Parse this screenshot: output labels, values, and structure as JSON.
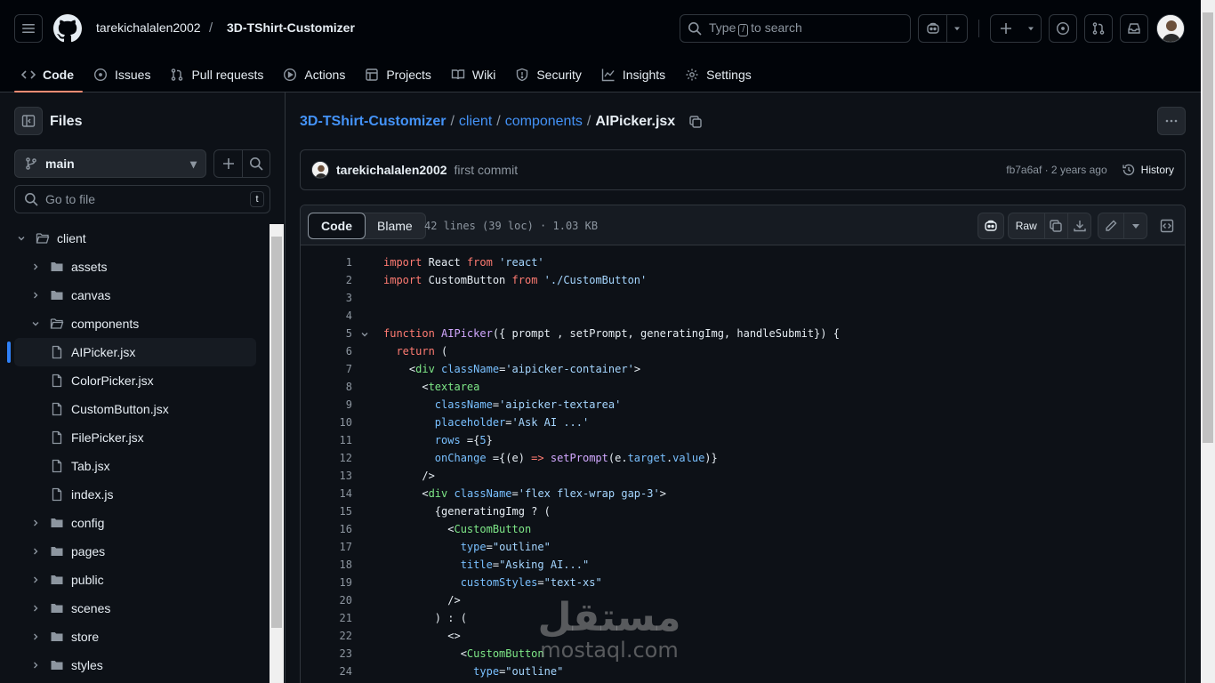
{
  "header": {
    "owner": "tarekichalalen2002",
    "separator": "/",
    "repo": "3D-TShirt-Customizer",
    "search": {
      "prefix": "Type",
      "key": "/",
      "suffix": "to search"
    }
  },
  "tabs": [
    {
      "label": "Code",
      "icon": "code-icon",
      "active": true
    },
    {
      "label": "Issues",
      "icon": "issue-icon"
    },
    {
      "label": "Pull requests",
      "icon": "pull-request-icon"
    },
    {
      "label": "Actions",
      "icon": "play-icon"
    },
    {
      "label": "Projects",
      "icon": "table-icon"
    },
    {
      "label": "Wiki",
      "icon": "book-icon"
    },
    {
      "label": "Security",
      "icon": "shield-icon"
    },
    {
      "label": "Insights",
      "icon": "graph-icon"
    },
    {
      "label": "Settings",
      "icon": "gear-icon"
    }
  ],
  "sidebar": {
    "title": "Files",
    "branch": "main",
    "goto_placeholder": "Go to file",
    "goto_key": "t",
    "tree": [
      {
        "label": "client",
        "type": "folder",
        "open": true,
        "depth": 0
      },
      {
        "label": "assets",
        "type": "folder",
        "depth": 1
      },
      {
        "label": "canvas",
        "type": "folder",
        "depth": 1
      },
      {
        "label": "components",
        "type": "folder",
        "open": true,
        "depth": 1
      },
      {
        "label": "AIPicker.jsx",
        "type": "file",
        "depth": 2,
        "selected": true
      },
      {
        "label": "ColorPicker.jsx",
        "type": "file",
        "depth": 2
      },
      {
        "label": "CustomButton.jsx",
        "type": "file",
        "depth": 2
      },
      {
        "label": "FilePicker.jsx",
        "type": "file",
        "depth": 2
      },
      {
        "label": "Tab.jsx",
        "type": "file",
        "depth": 2
      },
      {
        "label": "index.js",
        "type": "file",
        "depth": 2
      },
      {
        "label": "config",
        "type": "folder",
        "depth": 1
      },
      {
        "label": "pages",
        "type": "folder",
        "depth": 1
      },
      {
        "label": "public",
        "type": "folder",
        "depth": 1
      },
      {
        "label": "scenes",
        "type": "folder",
        "depth": 1
      },
      {
        "label": "store",
        "type": "folder",
        "depth": 1
      },
      {
        "label": "styles",
        "type": "folder",
        "depth": 1
      }
    ]
  },
  "path": {
    "repo": "3D-TShirt-Customizer",
    "dir1": "client",
    "dir2": "components",
    "file": "AIPicker.jsx",
    "sep": "/"
  },
  "commit": {
    "author": "tarekichalalen2002",
    "message": "first commit",
    "meta": "fb7a6af · 2 years ago",
    "history": "History"
  },
  "codeview": {
    "tab_code": "Code",
    "tab_blame": "Blame",
    "info": "42 lines (39 loc) · 1.03 KB",
    "raw": "Raw"
  },
  "code_lines": [
    {
      "n": "1",
      "h": "<span class=\"kw\">import</span> React <span class=\"kw\">from</span> <span class=\"st\">'react'</span>"
    },
    {
      "n": "2",
      "h": "<span class=\"kw\">import</span> CustomButton <span class=\"kw\">from</span> <span class=\"st\">'./CustomButton'</span>"
    },
    {
      "n": "3",
      "h": ""
    },
    {
      "n": "4",
      "h": ""
    },
    {
      "n": "5",
      "fold": true,
      "h": "<span class=\"kw\">function</span> <span class=\"fn\">AIPicker</span>({ prompt , setPrompt, generatingImg, handleSubmit}) {"
    },
    {
      "n": "6",
      "h": "  <span class=\"kw\">return</span> ("
    },
    {
      "n": "7",
      "h": "    &lt;<span class=\"tg\">div</span> <span class=\"at\">className</span>=<span class=\"st\">'aipicker-container'</span>&gt;"
    },
    {
      "n": "8",
      "h": "      &lt;<span class=\"tg\">textarea</span>"
    },
    {
      "n": "9",
      "h": "        <span class=\"at\">className</span>=<span class=\"st\">'aipicker-textarea'</span>"
    },
    {
      "n": "10",
      "h": "        <span class=\"at\">placeholder</span>=<span class=\"st\">'Ask AI ...'</span>"
    },
    {
      "n": "11",
      "h": "        <span class=\"at\">rows</span> ={<span class=\"at\">5</span>}"
    },
    {
      "n": "12",
      "h": "        <span class=\"at\">onChange</span> ={(e) <span class=\"kw\">=&gt;</span> <span class=\"fn\">setPrompt</span>(e.<span class=\"at\">target</span>.<span class=\"at\">value</span>)}"
    },
    {
      "n": "13",
      "h": "      /&gt;"
    },
    {
      "n": "14",
      "h": "      &lt;<span class=\"tg\">div</span> <span class=\"at\">className</span>=<span class=\"st\">'flex flex-wrap gap-3'</span>&gt;"
    },
    {
      "n": "15",
      "h": "        {generatingImg ? ("
    },
    {
      "n": "16",
      "h": "          &lt;<span class=\"tg\">CustomButton</span>"
    },
    {
      "n": "17",
      "h": "            <span class=\"at\">type</span>=<span class=\"st\">\"outline\"</span>"
    },
    {
      "n": "18",
      "h": "            <span class=\"at\">title</span>=<span class=\"st\">\"Asking AI...\"</span>"
    },
    {
      "n": "19",
      "h": "            <span class=\"at\">customStyles</span>=<span class=\"st\">\"text-xs\"</span>"
    },
    {
      "n": "20",
      "h": "          /&gt;"
    },
    {
      "n": "21",
      "h": "        ) : ("
    },
    {
      "n": "22",
      "h": "          &lt;&gt;"
    },
    {
      "n": "23",
      "h": "            &lt;<span class=\"tg\">CustomButton</span>"
    },
    {
      "n": "24",
      "h": "              <span class=\"at\">type</span>=<span class=\"st\">\"outline\"</span>"
    }
  ],
  "watermark": {
    "arabic": "مستقل",
    "latin": "mostaql.com"
  },
  "colors": {
    "bg": "#0d1117",
    "header_bg": "#010409",
    "link": "#4493f8",
    "active_tab": "#fd8c73",
    "border": "#30363d"
  }
}
